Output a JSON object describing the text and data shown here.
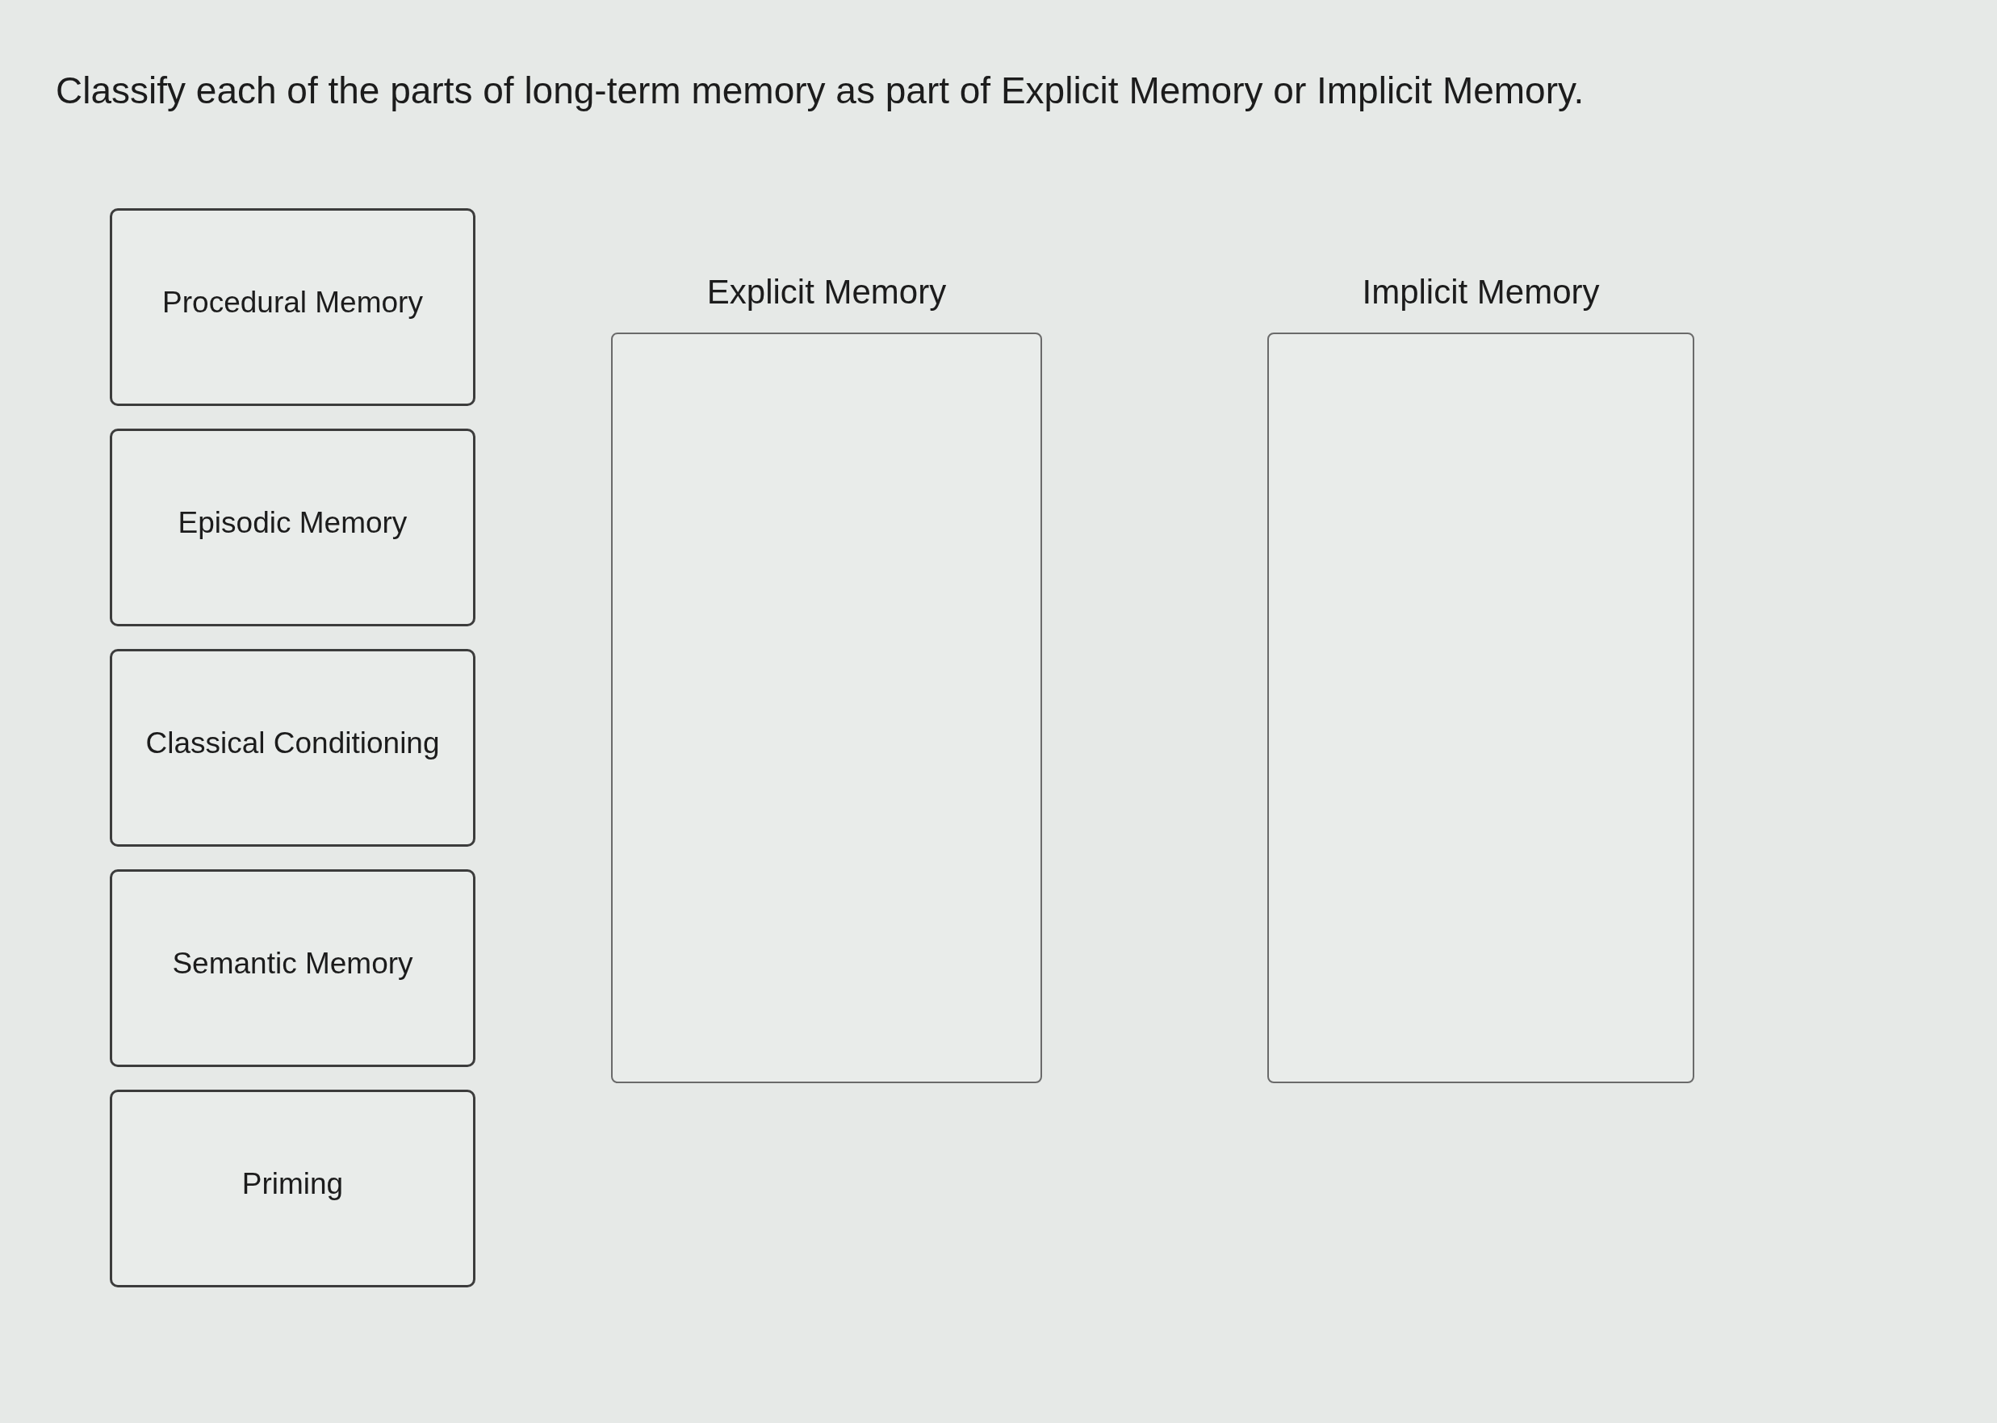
{
  "instruction": "Classify each of the parts of long-term memory as part of Explicit Memory or Implicit Memory.",
  "items": [
    "Procedural Memory",
    "Episodic Memory",
    "Classical Conditioning",
    "Semantic Memory",
    "Priming"
  ],
  "categories": [
    {
      "heading": "Explicit Memory"
    },
    {
      "heading": "Implicit Memory"
    }
  ]
}
